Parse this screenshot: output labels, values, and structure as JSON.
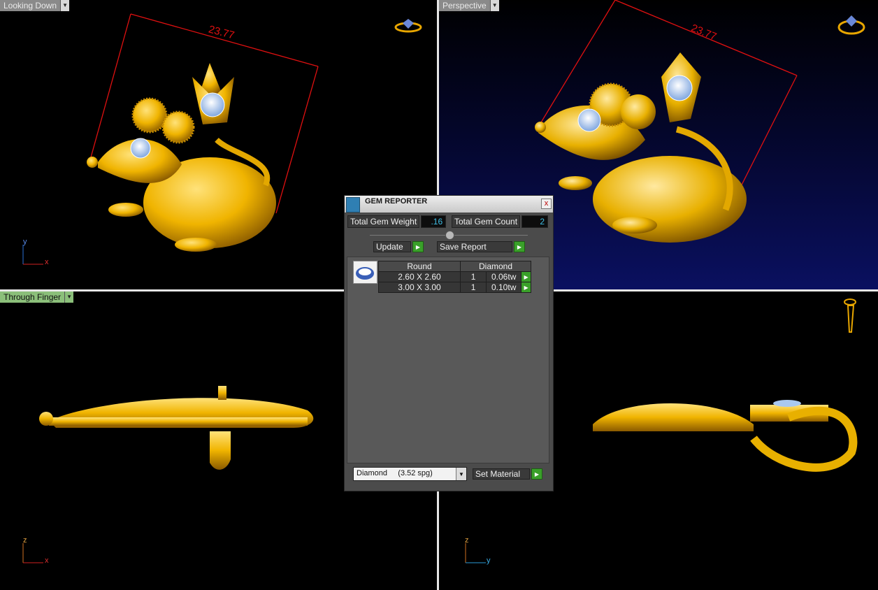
{
  "viewports": {
    "top_left": {
      "label": "Looking Down",
      "dimension": "23.77",
      "axis_v": "y",
      "axis_h": "x"
    },
    "top_right": {
      "label": "Perspective",
      "dimension": "23.77"
    },
    "bottom_left": {
      "label": "Through Finger",
      "axis_v": "z",
      "axis_h": "x"
    },
    "bottom_right": {
      "axis_v": "z",
      "axis_h": "y"
    }
  },
  "gem_reporter": {
    "title": "GEM REPORTER",
    "close": "x",
    "total_weight_label": "Total Gem Weight",
    "total_weight_value": ".16",
    "total_count_label": "Total Gem Count",
    "total_count_value": "2",
    "update_label": "Update",
    "save_report_label": "Save Report",
    "table": {
      "headers": [
        "Round",
        "Diamond"
      ],
      "rows": [
        {
          "size": "2.60 X 2.60",
          "qty": "1",
          "weight": "0.06tw"
        },
        {
          "size": "3.00 X 3.00",
          "qty": "1",
          "weight": "0.10tw"
        }
      ]
    },
    "material_value": "Diamond     (3.52 spg)",
    "set_material_label": "Set Material"
  },
  "colors": {
    "gold": "#f0b400",
    "gem": "#a9c8f0",
    "dimension": "#e01010",
    "go_button": "#3aa02a"
  }
}
